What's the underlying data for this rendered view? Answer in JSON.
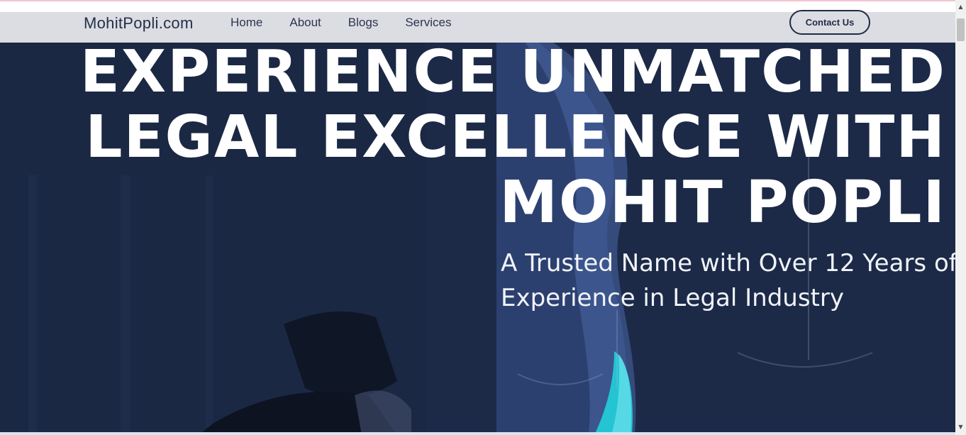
{
  "site": {
    "logo": "MohitPopli.com",
    "nav_items": [
      "Home",
      "About",
      "Blogs",
      "Services"
    ],
    "contact_label": "Contact Us"
  },
  "hero": {
    "headline_lines": [
      "EXPERIENCE UNMATCHED",
      "LEGAL EXCELLENCE WITH",
      "MOHIT POPLI"
    ],
    "subtitle_lines": [
      "A Trusted Name with Over 12 Years of",
      "Experience in Legal Industry"
    ]
  },
  "colors": {
    "navbar_bg": "#dcdde2",
    "hero_bg": "#1e2c4a",
    "hero_curve": "#3a5182",
    "accent_teal": "#24c4d3",
    "text_dark": "#24304a"
  },
  "icons": {
    "scroll_up": "scroll-up-arrow-icon",
    "scroll_down": "scroll-down-arrow-icon"
  }
}
